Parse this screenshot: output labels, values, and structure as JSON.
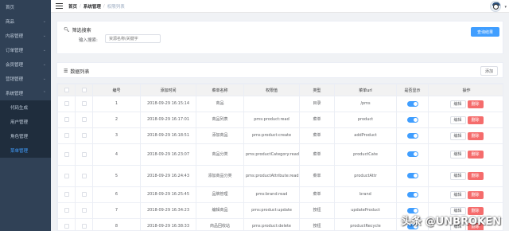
{
  "sidebar": {
    "items": [
      {
        "label": "首页",
        "arrow": ""
      },
      {
        "label": "商品",
        "arrow": "⌄"
      },
      {
        "label": "内容管理",
        "arrow": "⌄"
      },
      {
        "label": "订单管理",
        "arrow": "⌄"
      },
      {
        "label": "会员管理",
        "arrow": "⌄"
      },
      {
        "label": "营销管理",
        "arrow": "⌄"
      },
      {
        "label": "系统管理",
        "arrow": "⌃"
      }
    ],
    "submenu": [
      {
        "label": "代码生成"
      },
      {
        "label": "用户管理"
      },
      {
        "label": "角色管理"
      },
      {
        "label": "菜单管理"
      }
    ]
  },
  "header": {
    "breadcrumb": [
      "首页",
      "系统管理",
      "权限列表"
    ],
    "separator": "/"
  },
  "filter": {
    "title": "筛选搜索",
    "label": "输入搜索:",
    "placeholder": "资源名称/关键字",
    "query_button": "查询结果"
  },
  "list": {
    "title": "数据列表",
    "add_button": "添加"
  },
  "table": {
    "headers": [
      "",
      "",
      "编号",
      "添加时间",
      "菜单名称",
      "权限值",
      "类型",
      "菜单url",
      "是否显示",
      "操作"
    ],
    "edit_label": "编辑",
    "delete_label": "删除",
    "rows": [
      {
        "id": "1",
        "time": "2018-09-29 16:15:14",
        "name": "商品",
        "perm": "",
        "type": "目录",
        "url": "/pms"
      },
      {
        "id": "2",
        "time": "2018-09-29 16:17:01",
        "name": "商品列表",
        "perm": "pms:product:read",
        "type": "菜单",
        "url": "product"
      },
      {
        "id": "3",
        "time": "2018-09-29 16:18:51",
        "name": "添加商品",
        "perm": "pms:product:create",
        "type": "菜单",
        "url": "addProduct"
      },
      {
        "id": "4",
        "time": "2018-09-29 16:23:07",
        "name": "商品分类",
        "perm": "pms:productCategory:read",
        "type": "菜单",
        "url": "productCate"
      },
      {
        "id": "5",
        "time": "2018-09-29 16:24:43",
        "name": "添加商品分类",
        "perm": "pms:productAttribute:read",
        "type": "菜单",
        "url": "productAttr"
      },
      {
        "id": "6",
        "time": "2018-09-29 16:25:45",
        "name": "品牌管理",
        "perm": "pms:brand:read",
        "type": "菜单",
        "url": "brand"
      },
      {
        "id": "7",
        "time": "2018-09-29 16:34:23",
        "name": "编辑商品",
        "perm": "pms:product:update",
        "type": "按钮",
        "url": "updateProduct"
      },
      {
        "id": "8",
        "time": "2018-09-29 16:38:33",
        "name": "商品回收站",
        "perm": "pms:product:delete",
        "type": "按钮",
        "url": "productRecycle"
      }
    ]
  },
  "watermark": "头条 @UNBROKEN"
}
